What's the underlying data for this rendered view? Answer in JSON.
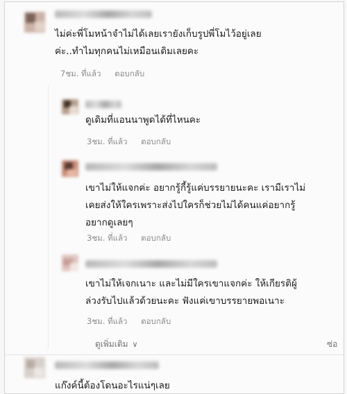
{
  "comments": [
    {
      "text_lines": [
        "ไม่ค่ะพี่โมหน้าจำไม่ได้เลยเรายังเก็บรูปพี่โมไว้อยู่เลย",
        "ค่ะ..ทำไมทุกคนไม่เหมือนเดิมเลยคะ"
      ],
      "time": "7ชม. ที่แล้ว",
      "reply": "ตอบกลับ"
    },
    {
      "text_lines": [
        "ดูเดิมที่แอนนาพูดได้ที่ไหนคะ"
      ],
      "time": "3ชม. ที่แล้ว",
      "reply": "ตอบกลับ"
    },
    {
      "text_lines": [
        "เขาไม่ให้แจกค่ะ อยากรู้กี้รู้แค่บรรยายนะคะ เรามีเราไม่",
        "เคยส่งให้ใครเพราะส่งไปใครก็ช่วยไม่ได้คนแค่อยากรู้",
        "อยากดูเลยๆ"
      ],
      "time": "3ชม. ที่แล้ว",
      "reply": "ตอบกลับ"
    },
    {
      "text_lines": [
        "เขาไม่ให้เจกเนาะ และไม่มีใครเขาแจกค่ะ ให้เกียรติผู้",
        "ล่วงรับไปแล้วด้วยนะคะ ฟังแค่เขาบรรยายพอเนาะ"
      ],
      "time": "3ชม. ที่แล้ว",
      "reply": "ตอบกลับ"
    },
    {
      "text_lines": [
        "แก๊งค์นี้ต้องโดนอะไรแน่ๆเลย"
      ]
    }
  ],
  "show_more": {
    "label": "ดูเพิ่มเติม",
    "icon": "chevron-down-icon"
  },
  "edge_text": "ซ่อ"
}
